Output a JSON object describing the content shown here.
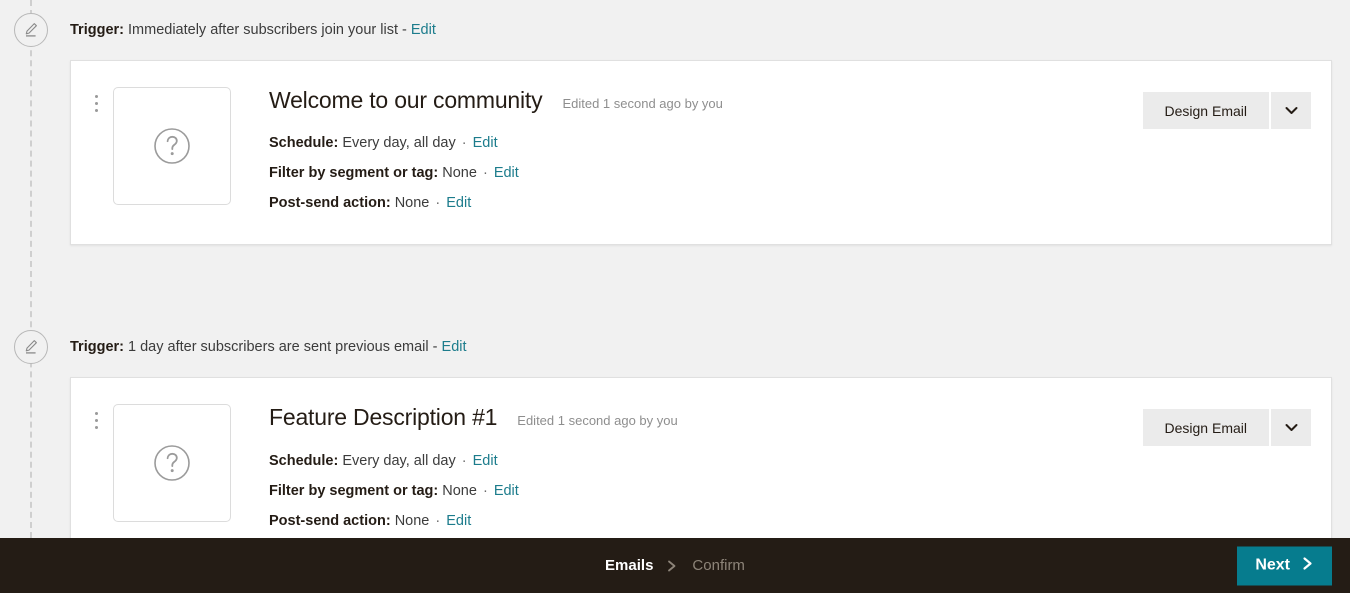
{
  "steps": [
    {
      "trigger": {
        "label": "Trigger:",
        "value": "Immediately after subscribers join your list",
        "separator": "-",
        "edit_label": "Edit",
        "icon": "pencil-icon"
      },
      "email": {
        "title": "Welcome to our community",
        "edited": "Edited 1 second ago by you",
        "thumbnail_icon": "question-mark-circle-icon",
        "kebab_icon": "more-vertical-icon",
        "meta": [
          {
            "key": "Schedule:",
            "value": "Every day, all day",
            "separator": "·",
            "edit_label": "Edit"
          },
          {
            "key": "Filter by segment or tag:",
            "value": "None",
            "separator": "·",
            "edit_label": "Edit"
          },
          {
            "key": "Post-send action:",
            "value": "None",
            "separator": "·",
            "edit_label": "Edit"
          }
        ],
        "action": {
          "label": "Design Email",
          "caret_icon": "chevron-down-icon"
        }
      }
    },
    {
      "trigger": {
        "label": "Trigger:",
        "value": "1 day after subscribers are sent previous email",
        "separator": "-",
        "edit_label": "Edit",
        "icon": "pencil-icon"
      },
      "email": {
        "title": "Feature Description #1",
        "edited": "Edited 1 second ago by you",
        "thumbnail_icon": "question-mark-circle-icon",
        "kebab_icon": "more-vertical-icon",
        "meta": [
          {
            "key": "Schedule:",
            "value": "Every day, all day",
            "separator": "·",
            "edit_label": "Edit"
          },
          {
            "key": "Filter by segment or tag:",
            "value": "None",
            "separator": "·",
            "edit_label": "Edit"
          },
          {
            "key": "Post-send action:",
            "value": "None",
            "separator": "·",
            "edit_label": "Edit"
          }
        ],
        "action": {
          "label": "Design Email",
          "caret_icon": "chevron-down-icon"
        }
      }
    }
  ],
  "footer": {
    "breadcrumbs": [
      {
        "label": "Emails",
        "active": true
      },
      {
        "label": "Confirm",
        "active": false
      }
    ],
    "separator_icon": "chevron-right-icon",
    "next": {
      "label": "Next",
      "icon": "chevron-right-icon"
    }
  },
  "colors": {
    "background": "#f1f1f1",
    "card": "#ffffff",
    "link": "#1c7c8c",
    "footer_bg": "#241c15",
    "primary_button": "#067c8e",
    "button_bg": "#ebebeb",
    "text": "#241c15",
    "muted_text": "#8e8e8e"
  }
}
